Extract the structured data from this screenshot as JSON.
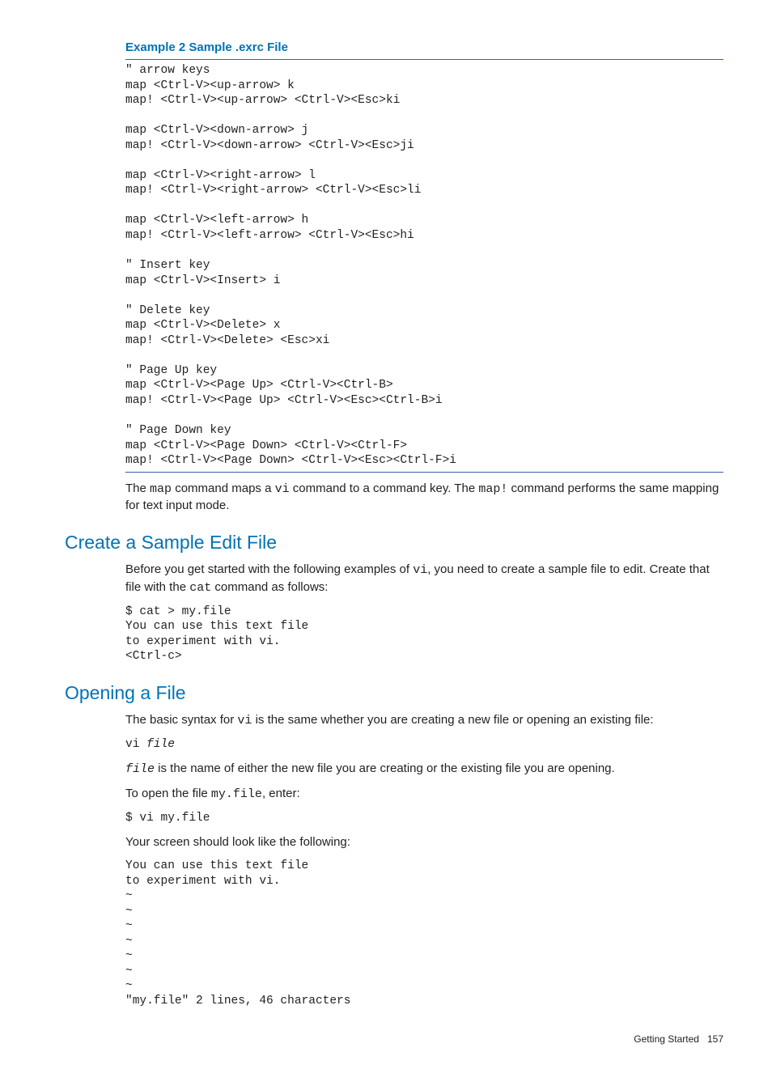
{
  "example": {
    "title": "Example 2 Sample .exrc File",
    "code": "\" arrow keys\nmap <Ctrl-V><up-arrow> k\nmap! <Ctrl-V><up-arrow> <Ctrl-V><Esc>ki\n\nmap <Ctrl-V><down-arrow> j\nmap! <Ctrl-V><down-arrow> <Ctrl-V><Esc>ji\n\nmap <Ctrl-V><right-arrow> l\nmap! <Ctrl-V><right-arrow> <Ctrl-V><Esc>li\n\nmap <Ctrl-V><left-arrow> h\nmap! <Ctrl-V><left-arrow> <Ctrl-V><Esc>hi\n\n\" Insert key\nmap <Ctrl-V><Insert> i\n\n\" Delete key\nmap <Ctrl-V><Delete> x\nmap! <Ctrl-V><Delete> <Esc>xi\n\n\" Page Up key\nmap <Ctrl-V><Page Up> <Ctrl-V><Ctrl-B>\nmap! <Ctrl-V><Page Up> <Ctrl-V><Esc><Ctrl-B>i\n\n\" Page Down key\nmap <Ctrl-V><Page Down> <Ctrl-V><Ctrl-F>\nmap! <Ctrl-V><Page Down> <Ctrl-V><Esc><Ctrl-F>i"
  },
  "para_map": {
    "pre1": "The ",
    "map": "map",
    "mid1": " command maps a ",
    "vi": "vi",
    "mid2": " command to a command key. The ",
    "mapbang": "map!",
    "post": " command performs the same mapping for text input mode."
  },
  "sec1": {
    "title": "Create a Sample Edit File",
    "p1a": "Before you get started with the following examples of ",
    "p1vi": "vi",
    "p1b": ", you need to create a sample file to edit. Create that file with the ",
    "p1cat": "cat",
    "p1c": " command as follows:",
    "code": "$ cat > my.file\nYou can use this text file\nto experiment with vi.\n<Ctrl-c>"
  },
  "sec2": {
    "title": "Opening a File",
    "p1a": "The basic syntax for ",
    "p1vi": "vi",
    "p1b": " is the same whether you are creating a new file or opening an existing file:",
    "syntax_cmd": "vi ",
    "syntax_arg": "file",
    "p2arg": "file",
    "p2rest": " is the name of either the new file you are creating or the existing file you are opening.",
    "p3a": "To open the file ",
    "p3file": "my.file",
    "p3b": ", enter:",
    "cmd": "$ vi my.file",
    "p4": "Your screen should look like the following:",
    "screen": "You can use this text file\nto experiment with vi.\n~\n~\n~\n~\n~\n~\n~\n\"my.file\" 2 lines, 46 characters"
  },
  "footer": {
    "section": "Getting Started",
    "page": "157"
  }
}
